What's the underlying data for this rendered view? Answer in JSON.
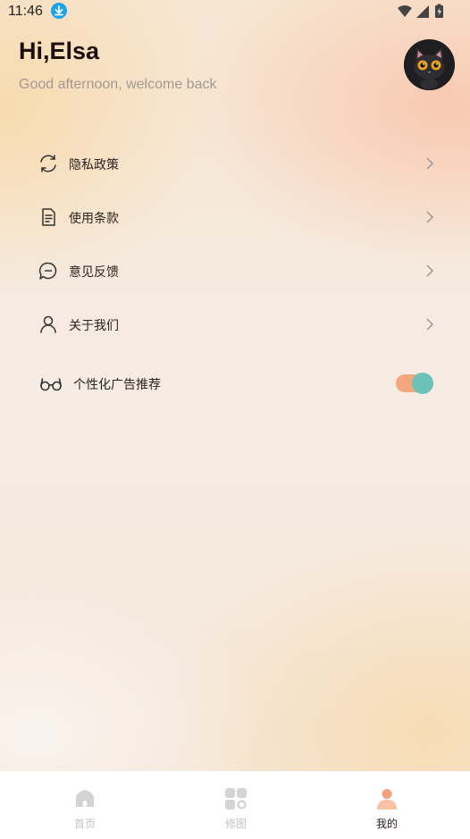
{
  "status_bar": {
    "time": "11:46",
    "download_icon": "download-icon",
    "wifi_icon": "wifi-icon",
    "signal_icon": "signal-icon",
    "battery_icon": "battery-charging-icon"
  },
  "header": {
    "greeting": "Hi,Elsa",
    "subtitle": "Good afternoon, welcome back",
    "avatar_icon": "cat-avatar"
  },
  "menu": {
    "items": [
      {
        "label": "隐私政策",
        "icon": "refresh-cycle-icon"
      },
      {
        "label": "使用条款",
        "icon": "document-icon"
      },
      {
        "label": "意见反馈",
        "icon": "chat-bubble-icon"
      },
      {
        "label": "关于我们",
        "icon": "person-icon"
      }
    ],
    "personalized_ads": {
      "label": "个性化广告推荐",
      "icon": "glasses-icon",
      "enabled": true
    }
  },
  "tabbar": {
    "tabs": [
      {
        "label": "首页",
        "icon": "home-icon",
        "active": false
      },
      {
        "label": "修图",
        "icon": "grid-apps-icon",
        "active": false
      },
      {
        "label": "我的",
        "icon": "profile-icon",
        "active": true
      }
    ]
  },
  "colors": {
    "accent_orange": "#f4a77d",
    "toggle_knob": "#6cc2b7",
    "tab_active": "#f0a27c",
    "tab_inactive": "#d4d4d4"
  }
}
